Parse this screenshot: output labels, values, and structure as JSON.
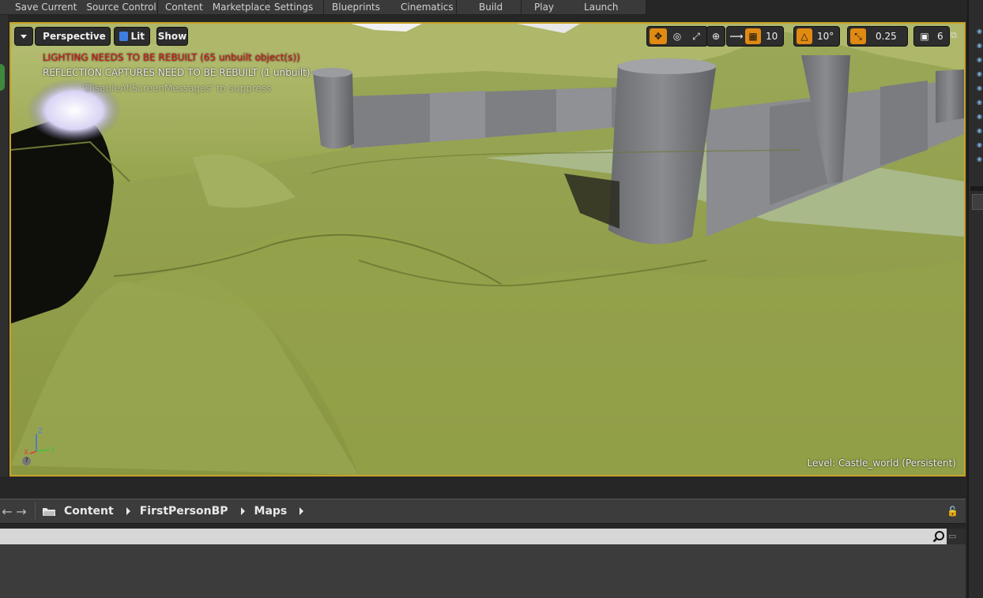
{
  "toolbar": {
    "save_current": "Save Current",
    "source_control": "Source Control",
    "content": "Content",
    "marketplace": "Marketplace",
    "settings": "Settings",
    "blueprints": "Blueprints",
    "cinematics": "Cinematics",
    "build": "Build",
    "play": "Play",
    "launch": "Launch"
  },
  "viewport": {
    "view_mode": "Perspective",
    "lighting_mode": "Lit",
    "show": "Show",
    "grid_snap": "10",
    "rotation_snap": "10°",
    "scale_snap": "0.25",
    "camera_speed": "6",
    "messages": {
      "lighting": "LIGHTING NEEDS TO BE REBUILT (65 unbuilt object(s))",
      "reflection": "REFLECTION CAPTURES NEED TO BE REBUILT (1 unbuilt)",
      "suppress": "'DisableAllScreenMessages' to suppress"
    },
    "level_label": "Level:  Castle_world (Persistent)",
    "axis": {
      "x": "X",
      "y": "Y",
      "z": "Z"
    },
    "colors": {
      "border": "#c9a227",
      "terrain": "#8f9d4a",
      "warning": "#d41a1a",
      "snap_active": "#e08a12"
    }
  },
  "content_browser": {
    "breadcrumb": [
      "Content",
      "FirstPersonBP",
      "Maps"
    ],
    "search_placeholder": ""
  }
}
